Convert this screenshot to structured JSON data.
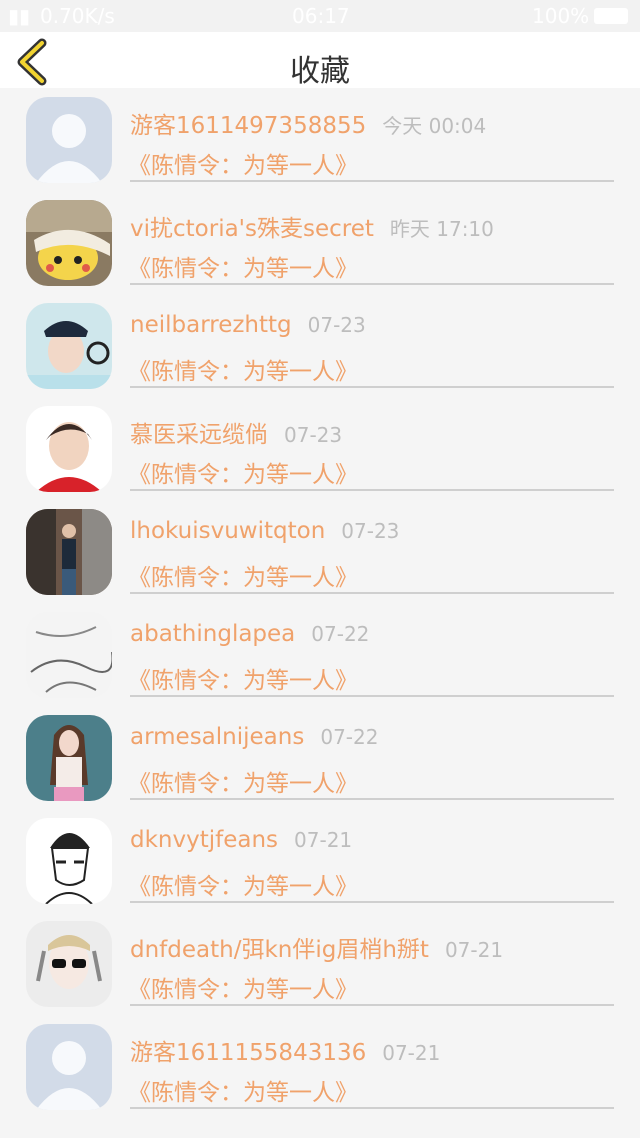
{
  "status": {
    "speed": "0.70K/s",
    "time": "06:17",
    "battery": "100%"
  },
  "header": {
    "title": "收藏"
  },
  "items": [
    {
      "name": "游客1611497358855",
      "time": "今天 00:04",
      "book": "《陈情令：为等一人》",
      "avatar": "default"
    },
    {
      "name": "vi扰ctoria's殊麦secret",
      "time": "昨天 17:10",
      "book": "《陈情令：为等一人》",
      "avatar": "pikachu"
    },
    {
      "name": "neilbarrezhttg",
      "time": "07-23",
      "book": "《陈情令：为等一人》",
      "avatar": "cap"
    },
    {
      "name": "慕医采远缆倘",
      "time": "07-23",
      "book": "《陈情令：为等一人》",
      "avatar": "boy"
    },
    {
      "name": "lhokuisvuwitqton",
      "time": "07-23",
      "book": "《陈情令：为等一人》",
      "avatar": "street"
    },
    {
      "name": "abathinglapea",
      "time": "07-22",
      "book": "《陈情令：为等一人》",
      "avatar": "sketch"
    },
    {
      "name": "armesalnijeans",
      "time": "07-22",
      "book": "《陈情令：为等一人》",
      "avatar": "woman"
    },
    {
      "name": "dknvytjfeans",
      "time": "07-21",
      "book": "《陈情令：为等一人》",
      "avatar": "beanie"
    },
    {
      "name": "dnfdeath/弭kn伴ig眉梢h掰t",
      "time": "07-21",
      "book": "《陈情令：为等一人》",
      "avatar": "sunglasses"
    },
    {
      "name": "游客1611155843136",
      "time": "07-21",
      "book": "《陈情令：为等一人》",
      "avatar": "default"
    }
  ]
}
